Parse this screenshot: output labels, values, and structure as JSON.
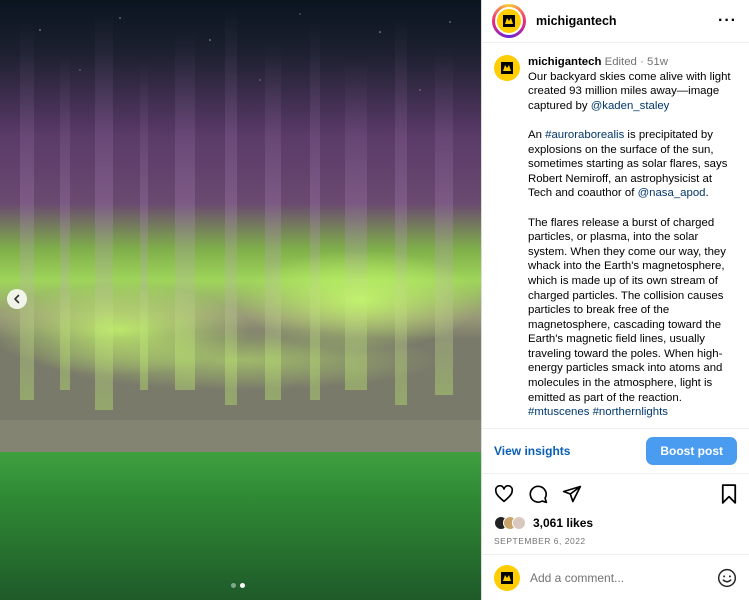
{
  "account": {
    "username": "michigantech"
  },
  "post": {
    "caption_username": "michigantech",
    "edited_label": "Edited",
    "age": "51w",
    "caption": [
      {
        "parts": [
          {
            "t": "Our backyard skies come alive with light created 93 million miles away—image captured by "
          },
          {
            "t": "@kaden_staley",
            "link": true
          }
        ]
      },
      {
        "parts": [
          {
            "t": "An "
          },
          {
            "t": "#auroraborealis",
            "link": true
          },
          {
            "t": " is precipitated by explosions on the surface of the sun, sometimes starting as solar flares, says Robert Nemiroff, an astrophysicist at Tech and coauthor of "
          },
          {
            "t": "@nasa_apod",
            "link": true
          },
          {
            "t": "."
          }
        ]
      },
      {
        "parts": [
          {
            "t": "The flares release a burst of charged particles, or plasma, into the solar system. When they come our way, they whack into the Earth's magnetosphere, which is made up of its own stream of charged particles. The collision causes particles to break free of the magnetosphere, cascading toward the Earth's magnetic field lines, usually traveling toward the poles. When high-energy particles smack into atoms and molecules in the atmosphere, light is emitted as part of the reaction. "
          },
          {
            "t": "#mtuscenes",
            "link": true
          },
          {
            "t": " "
          },
          {
            "t": "#northernlights",
            "link": true
          }
        ]
      }
    ],
    "view_insights": "View insights",
    "boost_label": "Boost post",
    "likes": "3,061 likes",
    "date": "SEPTEMBER 6, 2022",
    "comment_placeholder": "Add a comment..."
  },
  "carousel": {
    "slide_count": 2,
    "active_slide": 2
  },
  "colors": {
    "brand_yellow": "#ffcd00",
    "link": "#00376b",
    "boost": "#4a9cf0"
  },
  "icons": {
    "prev": "chevron-left-icon",
    "like": "heart-icon",
    "comment": "comment-icon",
    "share": "paper-plane-icon",
    "save": "bookmark-icon",
    "emoji": "smiley-icon",
    "more": "more-horizontal-icon"
  }
}
